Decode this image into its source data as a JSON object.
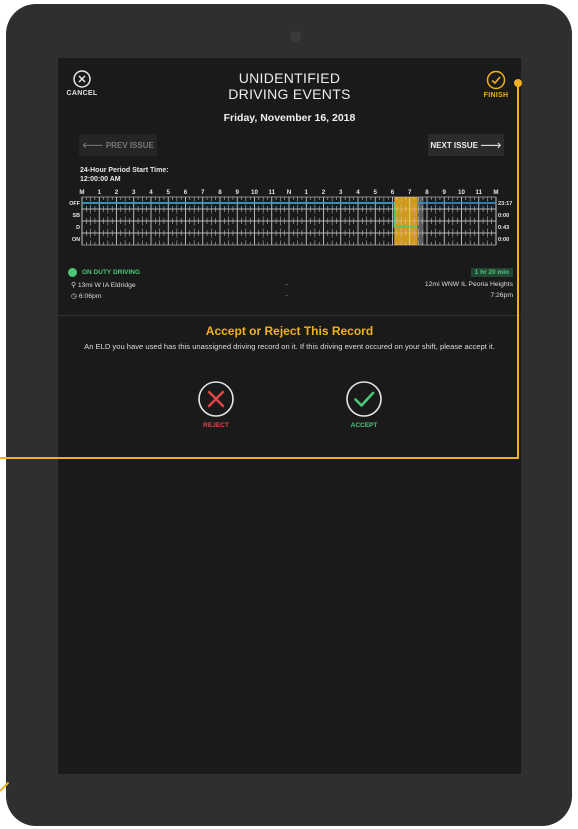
{
  "header": {
    "cancel_label": "CANCEL",
    "finish_label": "FINISH",
    "title_line1": "UNIDENTIFIED",
    "title_line2": "DRIVING EVENTS",
    "date": "Friday, November 16, 2018"
  },
  "nav": {
    "prev_label": "🡐 PREV ISSUE",
    "next_label": "NEXT ISSUE 🡒"
  },
  "period": {
    "line1": "24-Hour Period Start Time:",
    "line2": "12:00:00 AM"
  },
  "graph": {
    "hour_labels": [
      "M",
      "1",
      "2",
      "3",
      "4",
      "5",
      "6",
      "7",
      "8",
      "9",
      "10",
      "11",
      "N",
      "1",
      "2",
      "3",
      "4",
      "5",
      "6",
      "7",
      "8",
      "9",
      "10",
      "11",
      "M"
    ],
    "status_labels": [
      "OFF",
      "SB",
      "D",
      "ON"
    ],
    "totals": [
      "23:17",
      "0:00",
      "0:43",
      "0:00"
    ],
    "colors": {
      "line": "#2f9ae0",
      "highlight": "#f2b01e",
      "driving": "#4cc879"
    },
    "highlight_hours": [
      18.1,
      19.45
    ]
  },
  "event": {
    "status": "ON DUTY DRIVING",
    "duration": "1 hr 20 min",
    "from_location": "13mi W IA Eldridge",
    "to_location": "12mi WNW IL Peoria Heights",
    "arrow": "→",
    "start_time": "6:06pm",
    "end_time": "7:26pm"
  },
  "prompt": {
    "title": "Accept or Reject This Record",
    "text": "An ELD you have used has this unassigned driving record on it. If this driving event occured on your shift, please accept it."
  },
  "actions": {
    "reject_label": "REJECT",
    "accept_label": "ACCEPT"
  }
}
